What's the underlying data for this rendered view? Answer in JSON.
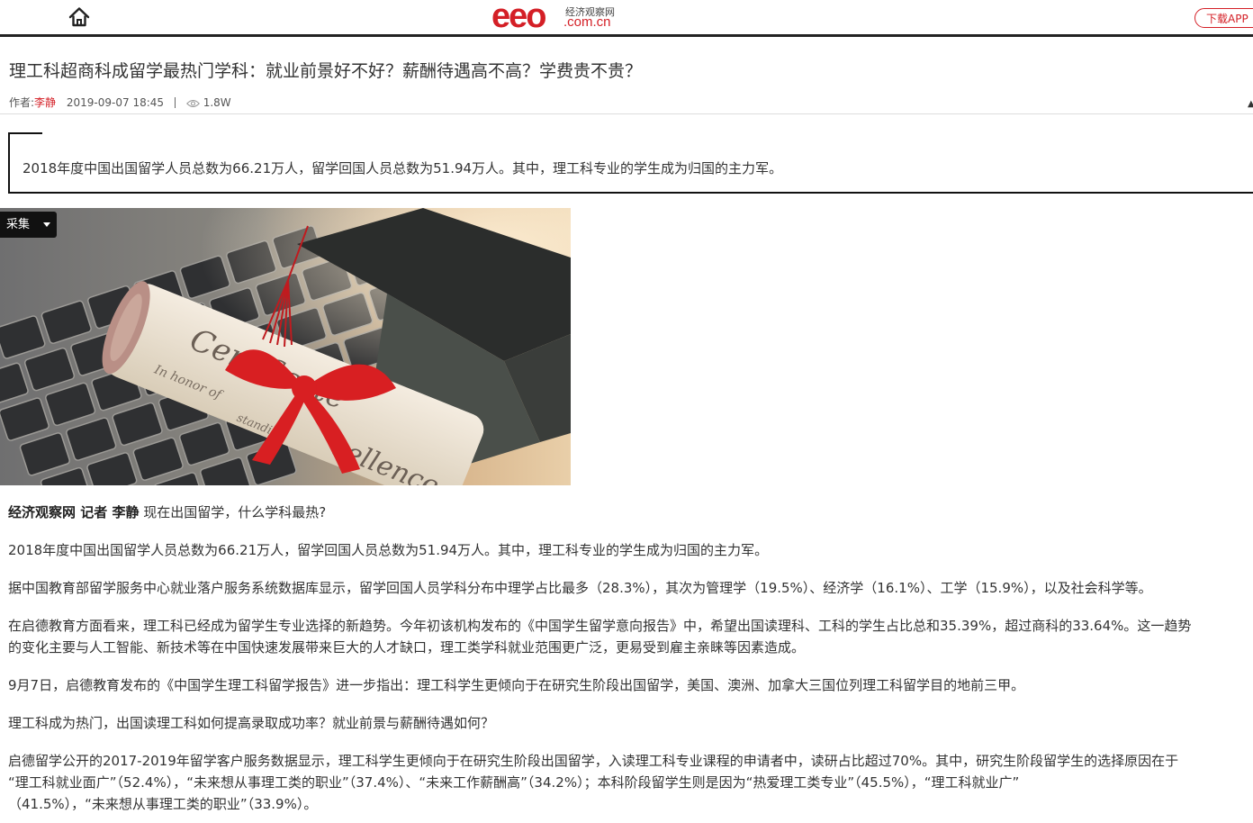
{
  "header": {
    "logo_text": "eeo",
    "logo_cn": "经济观察网",
    "logo_domain": ".com.cn",
    "download_label": "下载APP",
    "brand_color": "#d41f26"
  },
  "article": {
    "title": "理工科超商科成留学最热门学科：就业前景好不好？薪酬待遇高不高？学费贵不贵？",
    "author_label": "作者:",
    "author": "李静",
    "date": "2019-09-07 18:45",
    "views": "1.8W",
    "summary": "2018年度中国出国留学人员总数为66.21万人，留学回国人员总数为51.94万人。其中，理工科专业的学生成为归国的主力军。",
    "collect_label": "采集",
    "image_text": {
      "main": "Certificate",
      "sub": "In honor of",
      "line2": "standing",
      "line3": "ence and",
      "excellence": "cellence"
    },
    "lead_bold": "经济观察网 记者 李静",
    "lead_text": " 现在出国留学，什么学科最热?",
    "paragraphs": [
      "2018年度中国出国留学人员总数为66.21万人，留学回国人员总数为51.94万人。其中，理工科专业的学生成为归国的主力军。",
      "据中国教育部留学服务中心就业落户服务系统数据库显示，留学回国人员学科分布中理学占比最多（28.3%），其次为管理学（19.5%）、经济学（16.1%）、工学（15.9%），以及社会科学等。",
      "在启德教育方面看来，理工科已经成为留学生专业选择的新趋势。今年初该机构发布的《中国学生留学意向报告》中，希望出国读理科、工科的学生占比总和35.39%，超过商科的33.64%。这一趋势",
      "的变化主要与人工智能、新技术等在中国快速发展带来巨大的人才缺口，理工类学科就业范围更广泛，更易受到雇主亲睐等因素造成。",
      "9月7日，启德教育发布的《中国学生理工科留学报告》进一步指出：理工科学生更倾向于在研究生阶段出国留学，美国、澳洲、加拿大三国位列理工科留学目的地前三甲。",
      "理工科成为热门，出国读理工科如何提高录取成功率？就业前景与薪酬待遇如何？",
      "启德留学公开的2017-2019年留学客户服务数据显示，理工科学生更倾向于在研究生阶段出国留学，入读理工科专业课程的申请者中，读研占比超过70%。其中，研究生阶段留学生的选择原因在于",
      "“理工科就业面广”（52.4%），“未来想从事理工类的职业”（37.4%）、“未来工作薪酬高”（34.2%）；本科阶段留学生则是因为“热爱理工类专业”（45.5%），“理工科就业广”",
      "（41.5%），“未来想从事理工类的职业”（33.9%）。"
    ]
  }
}
